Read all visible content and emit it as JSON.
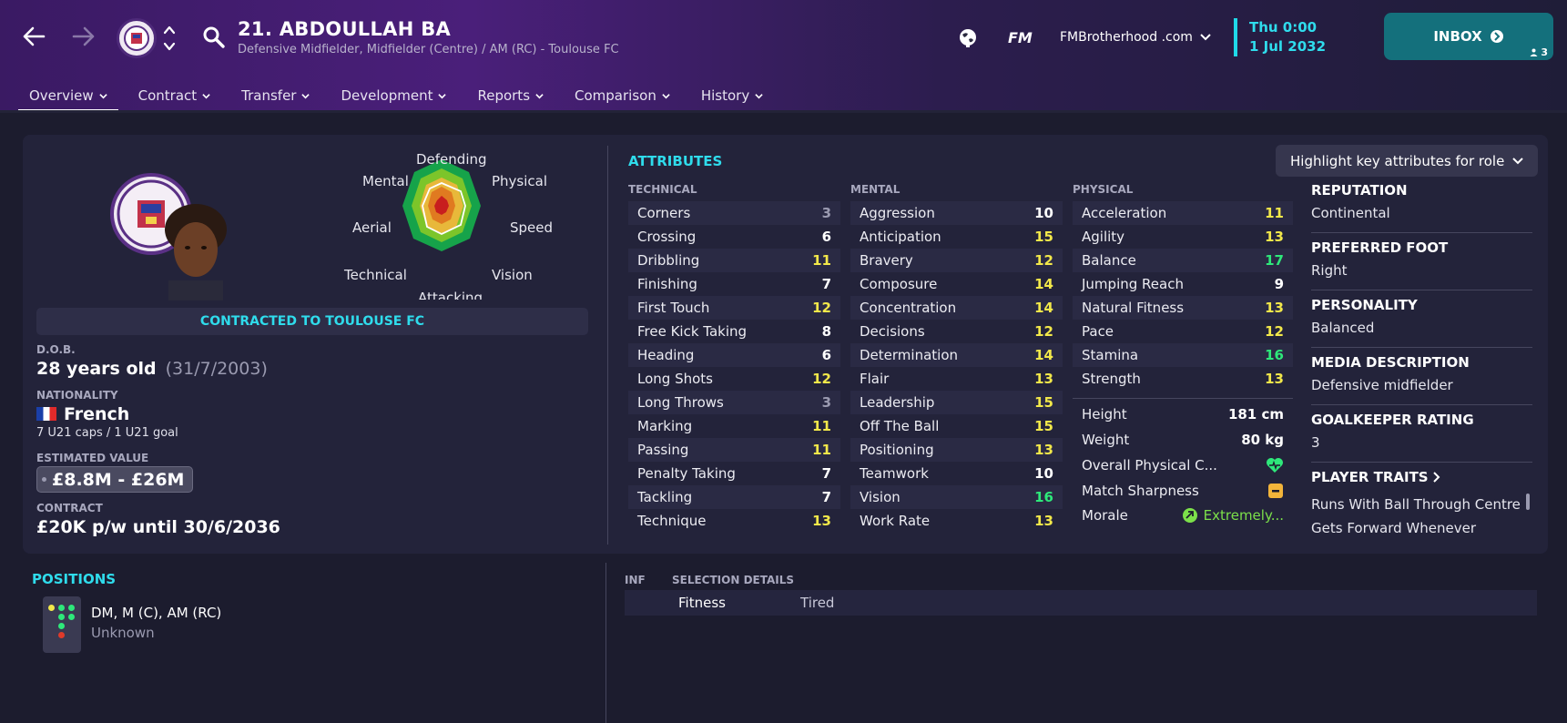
{
  "header": {
    "player_title": "21. ABDOULLAH BA",
    "player_subtitle": "Defensive Midfielder, Midfielder (Centre) / AM (RC) - Toulouse FC",
    "fm_logo": "FM",
    "skin": "FMBrotherhood .com",
    "date_day": "Thu 0:00",
    "date_full": "1 Jul 2032",
    "inbox_label": "INBOX",
    "inbox_count": "3"
  },
  "tabs": [
    {
      "label": "Overview"
    },
    {
      "label": "Contract"
    },
    {
      "label": "Transfer"
    },
    {
      "label": "Development"
    },
    {
      "label": "Reports"
    },
    {
      "label": "Comparison"
    },
    {
      "label": "History"
    }
  ],
  "radar": {
    "labels": [
      "Defending",
      "Physical",
      "Speed",
      "Vision",
      "Attacking",
      "Technical",
      "Aerial",
      "Mental"
    ]
  },
  "profile": {
    "contract_banner": "CONTRACTED TO TOULOUSE FC",
    "dob_label": "D.O.B.",
    "age": "28 years old",
    "dob": "(31/7/2003)",
    "nationality_label": "NATIONALITY",
    "nationality": "French",
    "caps": "7 U21 caps / 1 U21 goal",
    "value_label": "ESTIMATED VALUE",
    "value": "£8.8M - £26M",
    "contract_label": "CONTRACT",
    "contract": "£20K p/w until 30/6/2036"
  },
  "attributes": {
    "title": "ATTRIBUTES",
    "highlight_label": "Highlight key attributes for role",
    "technical_head": "TECHNICAL",
    "mental_head": "MENTAL",
    "physical_head": "PHYSICAL",
    "technical": [
      {
        "name": "Corners",
        "value": "3"
      },
      {
        "name": "Crossing",
        "value": "6"
      },
      {
        "name": "Dribbling",
        "value": "11"
      },
      {
        "name": "Finishing",
        "value": "7"
      },
      {
        "name": "First Touch",
        "value": "12"
      },
      {
        "name": "Free Kick Taking",
        "value": "8"
      },
      {
        "name": "Heading",
        "value": "6"
      },
      {
        "name": "Long Shots",
        "value": "12"
      },
      {
        "name": "Long Throws",
        "value": "3"
      },
      {
        "name": "Marking",
        "value": "11"
      },
      {
        "name": "Passing",
        "value": "11"
      },
      {
        "name": "Penalty Taking",
        "value": "7"
      },
      {
        "name": "Tackling",
        "value": "7"
      },
      {
        "name": "Technique",
        "value": "13"
      }
    ],
    "mental": [
      {
        "name": "Aggression",
        "value": "10"
      },
      {
        "name": "Anticipation",
        "value": "15"
      },
      {
        "name": "Bravery",
        "value": "12"
      },
      {
        "name": "Composure",
        "value": "14"
      },
      {
        "name": "Concentration",
        "value": "14"
      },
      {
        "name": "Decisions",
        "value": "12"
      },
      {
        "name": "Determination",
        "value": "14"
      },
      {
        "name": "Flair",
        "value": "13"
      },
      {
        "name": "Leadership",
        "value": "15"
      },
      {
        "name": "Off The Ball",
        "value": "15"
      },
      {
        "name": "Positioning",
        "value": "13"
      },
      {
        "name": "Teamwork",
        "value": "10"
      },
      {
        "name": "Vision",
        "value": "16"
      },
      {
        "name": "Work Rate",
        "value": "13"
      }
    ],
    "physical": [
      {
        "name": "Acceleration",
        "value": "11"
      },
      {
        "name": "Agility",
        "value": "13"
      },
      {
        "name": "Balance",
        "value": "17"
      },
      {
        "name": "Jumping Reach",
        "value": "9"
      },
      {
        "name": "Natural Fitness",
        "value": "13"
      },
      {
        "name": "Pace",
        "value": "12"
      },
      {
        "name": "Stamina",
        "value": "16"
      },
      {
        "name": "Strength",
        "value": "13"
      }
    ],
    "height_label": "Height",
    "height": "181 cm",
    "weight_label": "Weight",
    "weight": "80 kg",
    "condition_label": "Overall Physical C...",
    "sharpness_label": "Match Sharpness",
    "morale_label": "Morale",
    "morale": "Extremely..."
  },
  "side_info": {
    "reputation_label": "REPUTATION",
    "reputation": "Continental",
    "foot_label": "PREFERRED FOOT",
    "foot": "Right",
    "personality_label": "PERSONALITY",
    "personality": "Balanced",
    "media_label": "MEDIA DESCRIPTION",
    "media": "Defensive midfielder",
    "gk_label": "GOALKEEPER RATING",
    "gk": "3",
    "traits_label": "PLAYER TRAITS",
    "traits": [
      "Runs With Ball Through Centre",
      "Gets Forward Whenever"
    ]
  },
  "positions": {
    "title": "POSITIONS",
    "list": "DM, M (C), AM (RC)",
    "familiarity": "Unknown"
  },
  "selection": {
    "inf_head": "INF",
    "details_head": "SELECTION DETAILS",
    "row_label": "Fitness",
    "row_value": "Tired"
  },
  "colors": {
    "accent": "#2fdcec",
    "attr_high": "#2ee87a",
    "attr_mid": "#f2e84a",
    "attr_low": "#ffffff",
    "attr_poor": "#9a9ab0"
  }
}
